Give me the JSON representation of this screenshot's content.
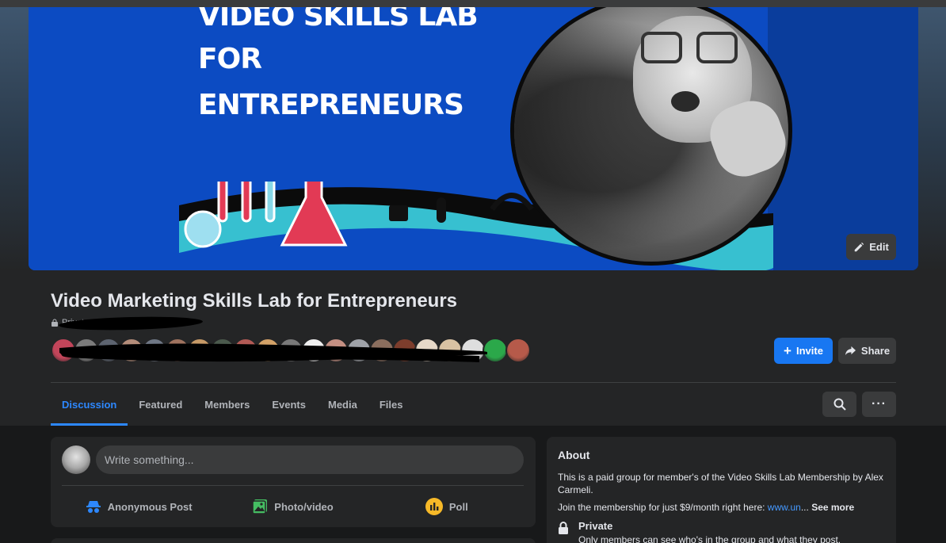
{
  "cover": {
    "title_lines": [
      "VIDEO SKILLS LAB",
      "FOR",
      "ENTREPRENEURS"
    ],
    "edit_label": "Edit"
  },
  "group": {
    "name": "Video Marketing Skills Lab for Entrepreneurs",
    "privacy": "Private g",
    "invite_label": "Invite",
    "share_label": "Share",
    "member_avatar_colors": [
      "#c2455a",
      "#7c7c7c",
      "#5d6470",
      "#b48d7a",
      "#6f7785",
      "#a0735f",
      "#c79a67",
      "#4b5a4d",
      "#b25a55",
      "#d3a268",
      "#797979",
      "#eeeeee",
      "#c48f82",
      "#9fa2a8",
      "#8b6e5e",
      "#7d3d2c",
      "#e6d8c8",
      "#d9c2a3",
      "#dedede",
      "#2ba84a",
      "#b65a4a"
    ]
  },
  "tabs": [
    {
      "label": "Discussion",
      "active": true
    },
    {
      "label": "Featured",
      "active": false
    },
    {
      "label": "Members",
      "active": false
    },
    {
      "label": "Events",
      "active": false
    },
    {
      "label": "Media",
      "active": false
    },
    {
      "label": "Files",
      "active": false
    }
  ],
  "composer": {
    "placeholder": "Write something...",
    "actions": [
      {
        "label": "Anonymous Post",
        "icon": "incognito-icon",
        "color": "#2d88ff"
      },
      {
        "label": "Photo/video",
        "icon": "photo-icon",
        "color": "#45bd62"
      },
      {
        "label": "Poll",
        "icon": "poll-icon",
        "color": "#f7b928"
      }
    ]
  },
  "about": {
    "heading": "About",
    "description": "This is a paid group for member's of the Video Skills Lab Membership by Alex Carmeli.",
    "join_text": "Join the membership for just $9/month right here: ",
    "join_link": "www.un",
    "ellipsis": "...",
    "see_more": "See more",
    "private_title": "Private",
    "private_desc": "Only members can see who's in the group and what they post."
  },
  "colors": {
    "accent": "#1877f2",
    "background": "#18191a",
    "card": "#242526"
  }
}
